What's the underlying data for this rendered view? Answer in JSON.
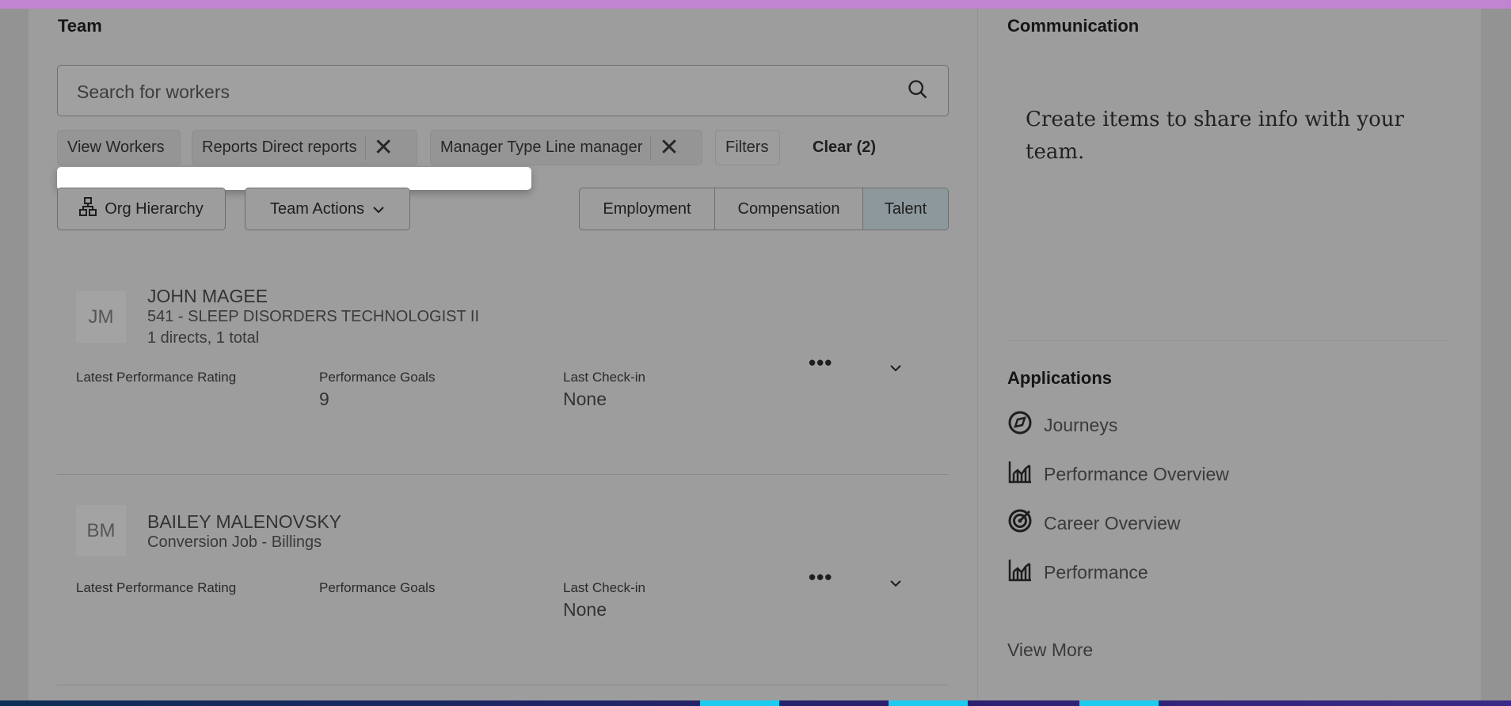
{
  "team": {
    "title": "Team",
    "search_placeholder": "Search for workers",
    "chips": [
      {
        "label": "View Workers"
      },
      {
        "label": "Reports Direct reports",
        "removable": true
      },
      {
        "label": "Manager Type Line manager",
        "removable": true
      }
    ],
    "filters_label": "Filters",
    "clear_label": "Clear (2)",
    "org_hierarchy_label": "Org Hierarchy",
    "team_actions_label": "Team Actions",
    "segments": [
      "Employment",
      "Compensation",
      "Talent"
    ],
    "selected_segment": "Talent",
    "workers": [
      {
        "initials": "JM",
        "name": "JOHN MAGEE",
        "job": "541 - SLEEP DISORDERS TECHNOLOGIST II",
        "reports": "1 directs, 1 total",
        "rating_label": "Latest Performance Rating",
        "rating": "",
        "goals_label": "Performance Goals",
        "goals": "9",
        "checkin_label": "Last Check-in",
        "checkin": "None"
      },
      {
        "initials": "BM",
        "name": "BAILEY MALENOVSKY",
        "job": "Conversion Job - Billings",
        "reports": "",
        "rating_label": "Latest Performance Rating",
        "rating": "",
        "goals_label": "Performance Goals",
        "goals": "",
        "checkin_label": "Last Check-in",
        "checkin": "None"
      }
    ]
  },
  "communication": {
    "title": "Communication",
    "message": "Create items to share info with your team."
  },
  "applications": {
    "title": "Applications",
    "items": [
      {
        "label": "Journeys",
        "icon": "compass-icon"
      },
      {
        "label": "Performance Overview",
        "icon": "bar-chart-icon"
      },
      {
        "label": "Career Overview",
        "icon": "target-icon"
      },
      {
        "label": "Performance",
        "icon": "bar-chart-icon"
      }
    ],
    "view_more": "View More"
  },
  "colors": {
    "top_bar": "#c184cf",
    "overlay": "#9d9d9d",
    "bottom_bar": "#0d2e57",
    "accent": "#1ccbee"
  }
}
